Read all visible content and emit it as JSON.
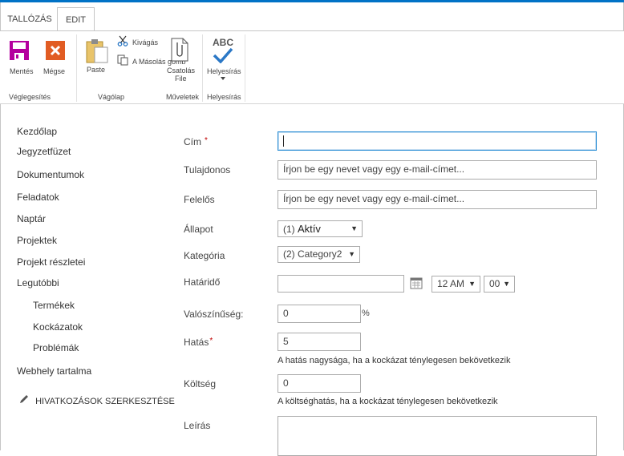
{
  "ribbon": {
    "tabs": [
      {
        "label": "TALLÓZÁS"
      },
      {
        "label": "EDIT"
      }
    ],
    "save_label": "Mentés",
    "cancel_label": "Mégse",
    "paste_label": "Paste",
    "cut_label": "Kivágás",
    "copy_label": "A Másolás gomb",
    "attach_label": "Csatolás",
    "attach_label2": "File",
    "spelling_label": "Helyesírás",
    "spelling_icon_text": "ABC",
    "groups": {
      "commit": "Véglegesítés",
      "clipboard": "Vágólap",
      "actions": "Műveletek",
      "spelling": "Helyesírás"
    }
  },
  "nav": {
    "items": [
      {
        "label": "Kezdőlap"
      },
      {
        "label": "Jegyzetfüzet"
      },
      {
        "label": "Dokumentumok"
      },
      {
        "label": "Feladatok"
      },
      {
        "label": "Naptár"
      },
      {
        "label": "Projektek"
      },
      {
        "label": "Projekt részletei"
      },
      {
        "label": "Legutóbbi"
      },
      {
        "label": "Termékek"
      },
      {
        "label": "Kockázatok"
      },
      {
        "label": "Problémák"
      },
      {
        "label": "Webhely tartalma"
      }
    ],
    "edit_links": "HIVATKOZÁSOK SZERKESZTÉSE"
  },
  "form": {
    "title": {
      "label": "Cím",
      "required_mark": "*",
      "value": ""
    },
    "owner": {
      "label": "Tulajdonos",
      "placeholder": "Írjon be egy nevet vagy egy e-mail-címet..."
    },
    "responsible": {
      "label": "Felelős",
      "placeholder": "Írjon be egy nevet vagy egy e-mail-címet..."
    },
    "status": {
      "label": "Állapot",
      "prefix": "(1)",
      "value": "Aktív"
    },
    "category": {
      "label": "Kategória",
      "value": "(2) Category2"
    },
    "due": {
      "label": "Határidő",
      "date": "",
      "hour": "12 AM",
      "minute": "00"
    },
    "probability": {
      "label": "Valószínűség:",
      "value": "0",
      "unit": "%"
    },
    "impact": {
      "label": "Hatás",
      "required_mark": "*",
      "value": "5",
      "hint": "A hatás nagysága, ha a kockázat ténylegesen bekövetkezik"
    },
    "cost": {
      "label": "Költség",
      "value": "0",
      "hint": "A költséghatás, ha a kockázat ténylegesen bekövetkezik"
    },
    "description": {
      "label": "Leírás",
      "value": ""
    }
  },
  "colors": {
    "accent": "#0072c6",
    "save_icon": "#b4009e",
    "cancel_icon": "#e15c23",
    "check_icon": "#2b78c6",
    "focus_border": "#2a8dd4"
  }
}
